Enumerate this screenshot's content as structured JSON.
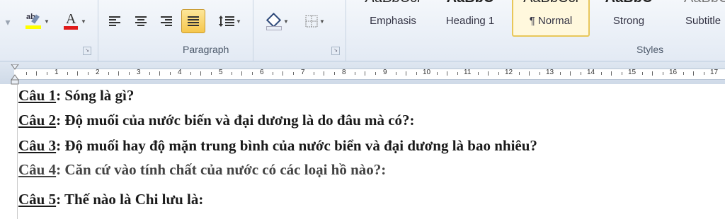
{
  "ribbon": {
    "paragraph_group_label": "Paragraph",
    "styles_group_label": "Styles",
    "font_color_letter": "A",
    "highlight_letter": "ab",
    "styles": [
      {
        "name": "Emphasis",
        "preview": "AaBbCcl"
      },
      {
        "name": "Heading 1",
        "preview": "AaBbC"
      },
      {
        "name": "¶ Normal",
        "preview": "AaBbCcl"
      },
      {
        "name": "Strong",
        "preview": "AaBbC"
      },
      {
        "name": "Subtitle",
        "preview": "AaBbCc"
      }
    ]
  },
  "ruler": {
    "numbers": [
      "1",
      "2",
      "3",
      "4",
      "5",
      "6",
      "7",
      "8",
      "9",
      "10",
      "11",
      "12",
      "13",
      "14",
      "15",
      "16",
      "17"
    ]
  },
  "document": {
    "questions": [
      {
        "label": "Câu 1",
        "text": ": Sóng là gì?"
      },
      {
        "label": "Câu 2",
        "text": ": Độ muối của nước biến và đại dương là do đâu mà có?:"
      },
      {
        "label": "Câu 3",
        "text": ": Độ muối hay độ mặn trung bình của nước biển và đại dương là bao nhiêu?"
      },
      {
        "label": "Câu 4",
        "text": ": Căn cứ vào tính chất của nước có các loại hồ nào?:"
      },
      {
        "label": "Câu 5",
        "text": ": Thế nào là Chi lưu là:"
      }
    ]
  }
}
